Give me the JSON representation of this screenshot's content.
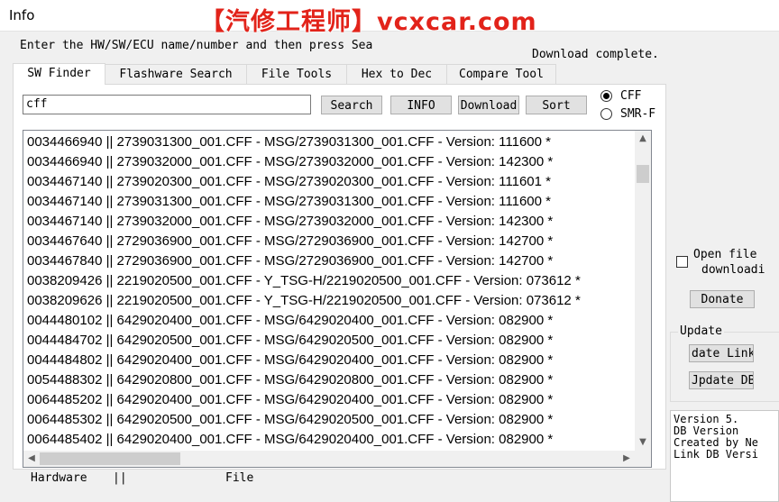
{
  "window": {
    "title": "Info"
  },
  "watermark": {
    "text": "【汽修工程师】vcxcar.com"
  },
  "instruction": "Enter the HW/SW/ECU name/number and then press Sea",
  "status": "Download complete.",
  "tabs": [
    {
      "label": "SW Finder",
      "active": true
    },
    {
      "label": "Flashware Search",
      "active": false
    },
    {
      "label": "File Tools",
      "active": false
    },
    {
      "label": "Hex to Dec",
      "active": false
    },
    {
      "label": "Compare Tool",
      "active": false
    }
  ],
  "search": {
    "value": "cff"
  },
  "buttons": {
    "search": "Search",
    "info": "INFO",
    "download": "Download",
    "sort": "Sort"
  },
  "radios": [
    {
      "label": "CFF",
      "selected": true
    },
    {
      "label": "SMR-F",
      "selected": false
    }
  ],
  "results": [
    "0034466940 || 2739031300_001.CFF - MSG/2739031300_001.CFF - Version: 111600 *",
    "0034466940 || 2739032000_001.CFF - MSG/2739032000_001.CFF - Version: 142300 *",
    "0034467140 || 2739020300_001.CFF - MSG/2739020300_001.CFF - Version: 111601 *",
    "0034467140 || 2739031300_001.CFF - MSG/2739031300_001.CFF - Version: 111600 *",
    "0034467140 || 2739032000_001.CFF - MSG/2739032000_001.CFF - Version: 142300 *",
    "0034467640 || 2729036900_001.CFF - MSG/2729036900_001.CFF - Version: 142700 *",
    "0034467840 || 2729036900_001.CFF - MSG/2729036900_001.CFF - Version: 142700 *",
    "0038209426 || 2219020500_001.CFF - Y_TSG-H/2219020500_001.CFF - Version: 073612 *",
    "0038209626 || 2219020500_001.CFF - Y_TSG-H/2219020500_001.CFF - Version: 073612 *",
    "0044480102 || 6429020400_001.CFF - MSG/6429020400_001.CFF - Version: 082900 *",
    "0044484702 || 6429020500_001.CFF - MSG/6429020500_001.CFF - Version: 082900 *",
    "0044484802 || 6429020400_001.CFF - MSG/6429020400_001.CFF - Version: 082900 *",
    "0054488302 || 6429020800_001.CFF - MSG/6429020800_001.CFF - Version: 082900 *",
    "0064485202 || 6429020400_001.CFF - MSG/6429020400_001.CFF - Version: 082900 *",
    "0064485302 || 6429020500_001.CFF - MSG/6429020500_001.CFF - Version: 082900 *",
    "0064485402 || 6429020400_001.CFF - MSG/6429020400_001.CFF - Version: 082900 *"
  ],
  "footer": {
    "hardware": "Hardware",
    "separator": "||",
    "file": "File"
  },
  "side": {
    "open_file_line1": "Open file",
    "open_file_line2": "downloadi",
    "donate": "Donate",
    "update_group": "Update",
    "update_link": "date Link",
    "update_db": "Jpdate DB",
    "info_lines": [
      "Version 5.",
      "DB Version",
      "Created by Ne",
      "Link DB Versi"
    ]
  },
  "icons": {
    "scroll_up": "chevron-up-icon",
    "scroll_down": "chevron-down-icon",
    "scroll_left": "chevron-left-icon",
    "scroll_right": "chevron-right-icon"
  },
  "colors": {
    "watermark": "#e2231a",
    "window_bg": "#f0f0f0",
    "panel_bg": "#ffffff"
  }
}
